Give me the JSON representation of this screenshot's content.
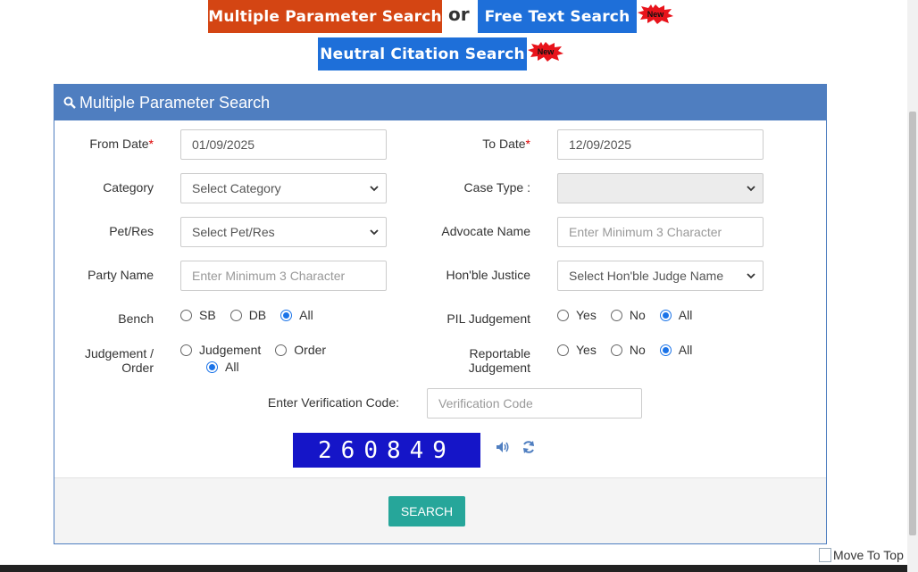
{
  "top_buttons": {
    "multiple": "Multiple Parameter Search",
    "or": "or",
    "free_text": "Free Text Search",
    "neutral": "Neutral Citation Search",
    "new_badge": "New"
  },
  "colors": {
    "multiple_btn": "#d44513",
    "blue_btn": "#1e6fd9",
    "panel_header": "#4f7ec0",
    "search_btn": "#26a69a",
    "radio_checked": "#1a73e8",
    "captcha_bg": "#1515c8"
  },
  "panel": {
    "title": "Multiple Parameter Search",
    "icon": "search-icon"
  },
  "form": {
    "from_date_label": "From Date",
    "from_date_value": "01/09/2025",
    "to_date_label": "To Date",
    "to_date_value": "12/09/2025",
    "required_mark": "*",
    "category_label": "Category",
    "category_value": "Select Category",
    "case_type_label": "Case Type :",
    "case_type_value": "",
    "pet_res_label": "Pet/Res",
    "pet_res_value": "Select Pet/Res",
    "advocate_label": "Advocate Name",
    "advocate_placeholder": "Enter Minimum 3 Character",
    "party_label": "Party Name",
    "party_placeholder": "Enter Minimum 3 Character",
    "justice_label": "Hon'ble Justice",
    "justice_value": "Select Hon'ble Judge Name",
    "bench_label": "Bench",
    "bench_options": [
      "SB",
      "DB",
      "All"
    ],
    "bench_selected": "All",
    "pil_label": "PIL Judgement",
    "pil_options": [
      "Yes",
      "No",
      "All"
    ],
    "pil_selected": "All",
    "jo_label_line1": "Judgement /",
    "jo_label_line2": "Order",
    "jo_options": [
      "Judgement",
      "Order",
      "All"
    ],
    "jo_selected": "All",
    "rep_label_line1": "Reportable",
    "rep_label_line2": "Judgement",
    "rep_options": [
      "Yes",
      "No",
      "All"
    ],
    "rep_selected": "All",
    "verification_label": "Enter Verification Code:",
    "verification_placeholder": "Verification Code",
    "captcha_text": "260849",
    "search_button": "SEARCH"
  },
  "move_to_top": "Move To Top"
}
